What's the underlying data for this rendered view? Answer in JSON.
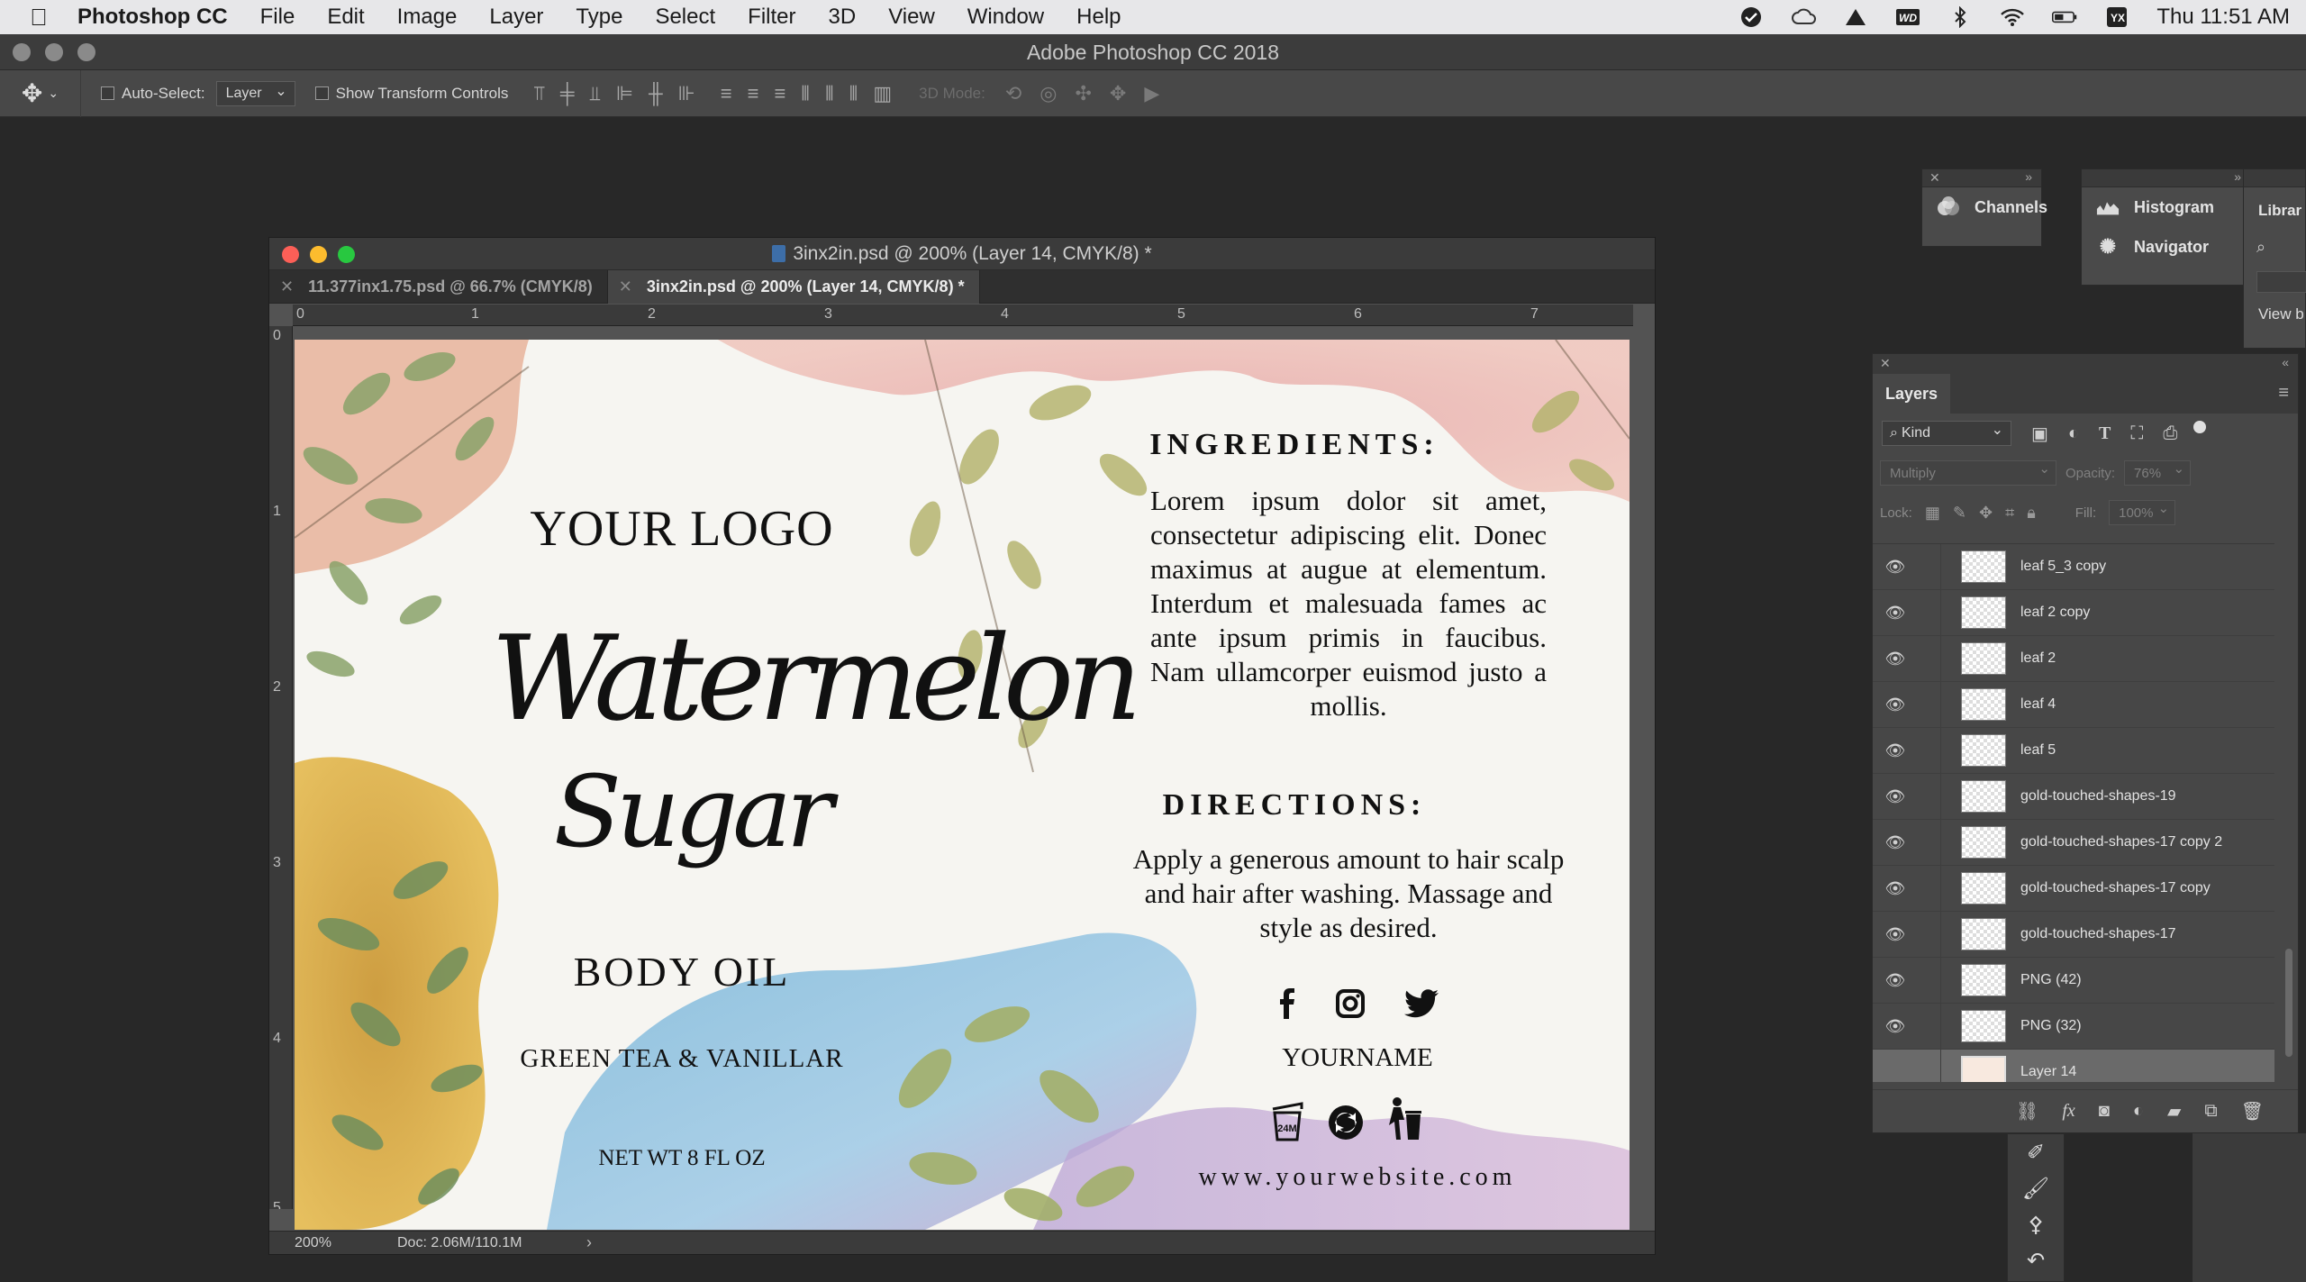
{
  "menubar": {
    "apple": "",
    "items": [
      "Photoshop CC",
      "File",
      "Edit",
      "Image",
      "Layer",
      "Type",
      "Select",
      "Filter",
      "3D",
      "View",
      "Window",
      "Help"
    ],
    "status_icons": [
      "checkmark-icon",
      "creative-cloud-icon",
      "drive-icon",
      "wd-icon",
      "bluetooth-icon",
      "wifi-icon",
      "battery-icon",
      "input-source-icon"
    ],
    "clock": "Thu 11:51 AM"
  },
  "app": {
    "title": "Adobe Photoshop CC 2018"
  },
  "options": {
    "auto_select_label": "Auto-Select:",
    "auto_select_value": "Layer",
    "transform_label": "Show Transform Controls",
    "mode3d_label": "3D Mode:"
  },
  "document": {
    "title": "3inx2in.psd @ 200% (Layer 14, CMYK/8) *",
    "tabs": [
      {
        "label": "11.377inx1.75.psd @ 66.7% (CMYK/8)",
        "active": false
      },
      {
        "label": "3inx2in.psd @ 200% (Layer 14, CMYK/8) *",
        "active": true
      }
    ],
    "hruler": [
      "0",
      "1",
      "2",
      "3",
      "4",
      "5",
      "6",
      "7"
    ],
    "vruler": [
      "0",
      "1",
      "2",
      "3",
      "4",
      "5"
    ],
    "zoom": "200%",
    "doc_info": "Doc: 2.06M/110.1M"
  },
  "label": {
    "logo": "YOUR LOGO",
    "script_line1": "Watermelon",
    "script_line2": "Sugar",
    "product": "BODY OIL",
    "scent": "GREEN TEA & VANILLAR",
    "net_wt": "NET WT 8 FL OZ",
    "ingredients_heading": "INGREDIENTS:",
    "ingredients_body": "Lorem ipsum dolor sit amet, consectetur adipiscing elit. Donec maximus at augue at elementum. Interdum et malesuada fames ac ante ipsum primis in faucibus. Nam ullamcorper euismod justo a mollis.",
    "directions_heading": "DIRECTIONS:",
    "directions_body": "Apply a generous amount to hair scalp and hair after washing. Massage and style as desired.",
    "your_name": "YOURNAME",
    "website": "www.yourwebsite.com",
    "period_after_opening": "24M"
  },
  "panels": {
    "channels": "Channels",
    "histogram": "Histogram",
    "navigator": "Navigator",
    "libraries": "Librar",
    "view_by": "View b"
  },
  "layers": {
    "tab": "Layers",
    "kind": "Kind",
    "blend_mode": "Multiply",
    "opacity_label": "Opacity:",
    "opacity_value": "76%",
    "lock_label": "Lock:",
    "fill_label": "Fill:",
    "fill_value": "100%",
    "items": [
      {
        "name": "leaf 5_3 copy",
        "visible": true
      },
      {
        "name": "leaf 2 copy",
        "visible": true
      },
      {
        "name": "leaf 2",
        "visible": true
      },
      {
        "name": "leaf 4",
        "visible": true
      },
      {
        "name": "leaf 5",
        "visible": true
      },
      {
        "name": "gold-touched-shapes-19",
        "visible": true
      },
      {
        "name": "gold-touched-shapes-17 copy 2",
        "visible": true
      },
      {
        "name": "gold-touched-shapes-17 copy",
        "visible": true
      },
      {
        "name": "gold-touched-shapes-17",
        "visible": true
      },
      {
        "name": "PNG  (42)",
        "visible": true
      },
      {
        "name": "PNG  (32)",
        "visible": true
      },
      {
        "name": "Layer 14",
        "visible": false,
        "selected": true
      }
    ]
  }
}
